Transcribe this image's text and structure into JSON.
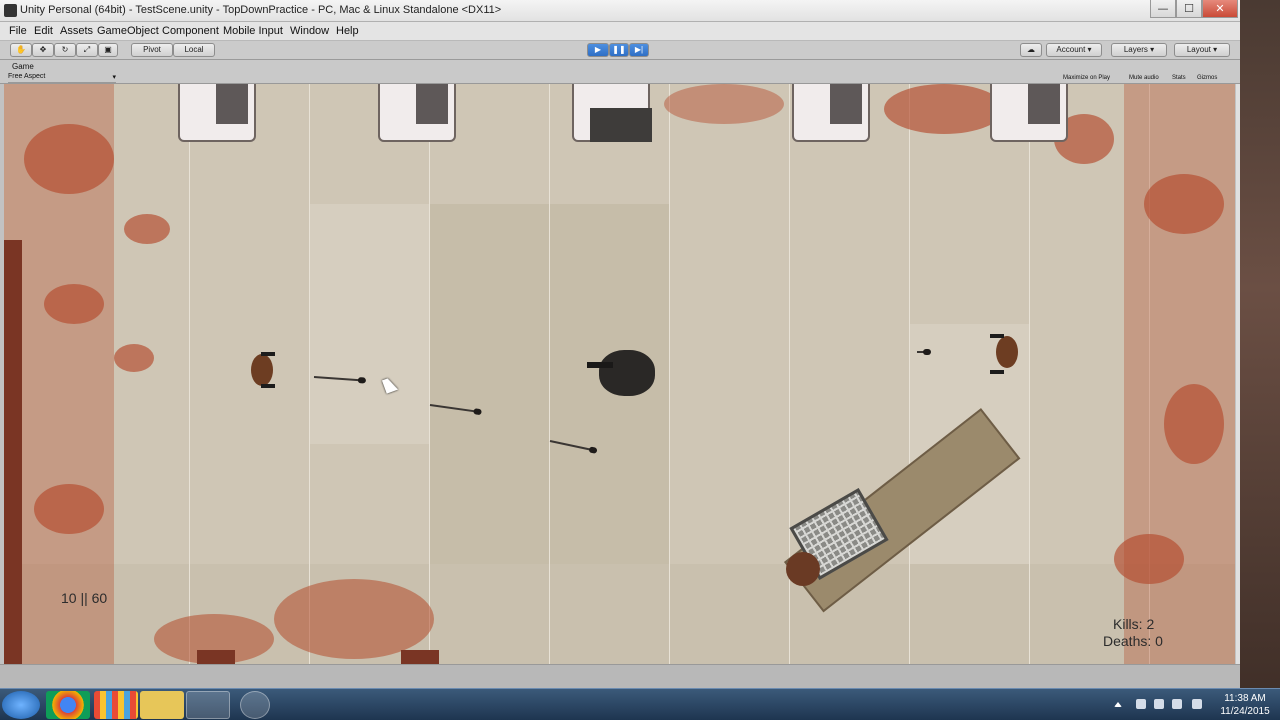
{
  "window": {
    "title": "Unity Personal (64bit) - TestScene.unity - TopDownPractice - PC, Mac & Linux Standalone <DX11>",
    "controls": [
      "—",
      "☐",
      "✕"
    ]
  },
  "menu": [
    "File",
    "Edit",
    "Assets",
    "GameObject",
    "Component",
    "Mobile Input",
    "Window",
    "Help"
  ],
  "toolbar": {
    "pivot": "Pivot",
    "local": "Local",
    "account": "Account",
    "layers": "Layers",
    "layout": "Layout"
  },
  "game_view": {
    "tab_label": "Game",
    "aspect": "Free Aspect",
    "options": [
      "Maximize on Play",
      "Mute audio",
      "Stats",
      "Gizmos"
    ],
    "ammo": "10 || 60",
    "kills": "Kills: 2",
    "deaths": "Deaths: 0"
  },
  "taskbar": {
    "time": "11:38 AM",
    "date": "11/24/2015"
  },
  "colors": {
    "floor": "#cfc6b5",
    "blood": "#b34a2c",
    "play_button": "#2f6fc5"
  }
}
